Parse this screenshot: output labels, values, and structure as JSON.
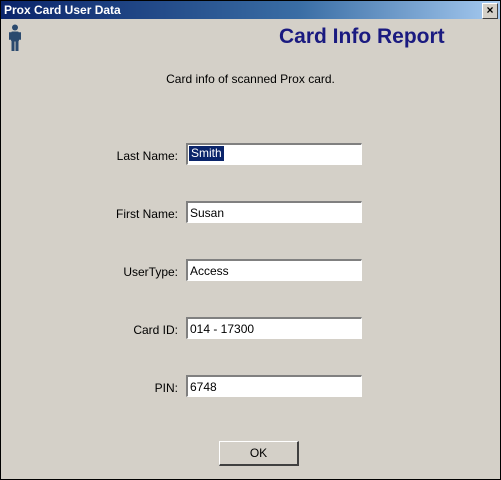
{
  "window": {
    "title": "Prox Card User Data",
    "close_glyph": "✕",
    "icon": "person-icon"
  },
  "header": {
    "title": "Card Info Report",
    "title_color": "#1a1a80"
  },
  "subtitle": "Card info of scanned Prox card.",
  "fields": [
    {
      "label": "Last Name:",
      "value": "Smith"
    },
    {
      "label": "First Name:",
      "value": "Susan"
    },
    {
      "label": "UserType:",
      "value": "Access"
    },
    {
      "label": "Card ID:",
      "value": "014 - 17300"
    },
    {
      "label": "PIN:",
      "value": "6748"
    }
  ],
  "buttons": {
    "ok_label": "OK"
  }
}
